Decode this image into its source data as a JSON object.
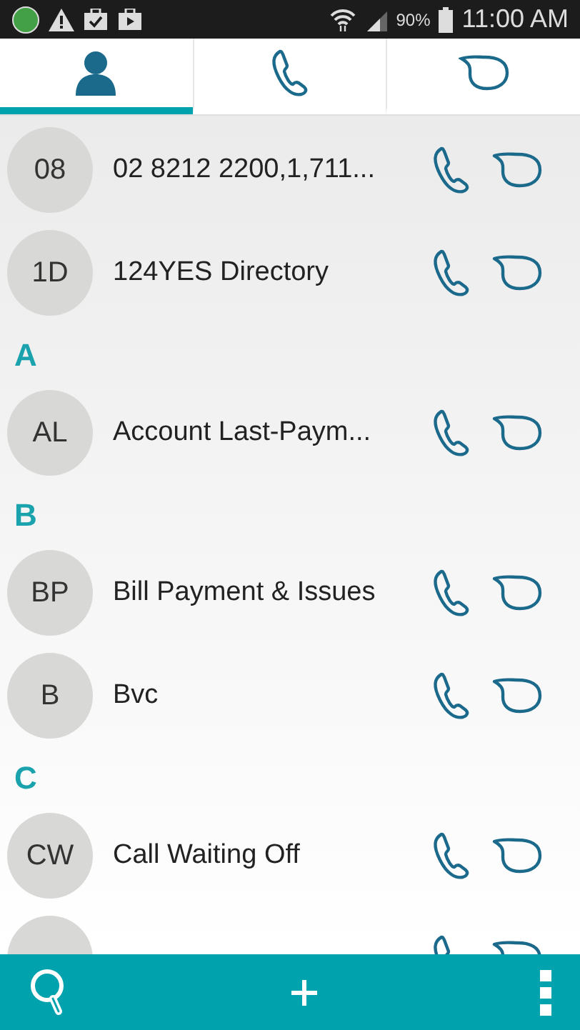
{
  "status_bar": {
    "battery_percent": "90%",
    "time": "11:00 AM"
  },
  "tabs": [
    {
      "kind": "contacts",
      "selected": true
    },
    {
      "kind": "calls",
      "selected": false
    },
    {
      "kind": "messages",
      "selected": false
    }
  ],
  "list": [
    {
      "kind": "contact",
      "initials": "08",
      "name": "02 8212 2200,1,711..."
    },
    {
      "kind": "contact",
      "initials": "1D",
      "name": "124YES Directory"
    },
    {
      "kind": "header",
      "letter": "A"
    },
    {
      "kind": "contact",
      "initials": "AL",
      "name": "Account Last-Paym..."
    },
    {
      "kind": "header",
      "letter": "B"
    },
    {
      "kind": "contact",
      "initials": "BP",
      "name": "Bill Payment & Issues"
    },
    {
      "kind": "contact",
      "initials": "B",
      "name": "Bvc"
    },
    {
      "kind": "header",
      "letter": "C"
    },
    {
      "kind": "contact",
      "initials": "CW",
      "name": "Call Waiting Off"
    },
    {
      "kind": "partial"
    }
  ]
}
